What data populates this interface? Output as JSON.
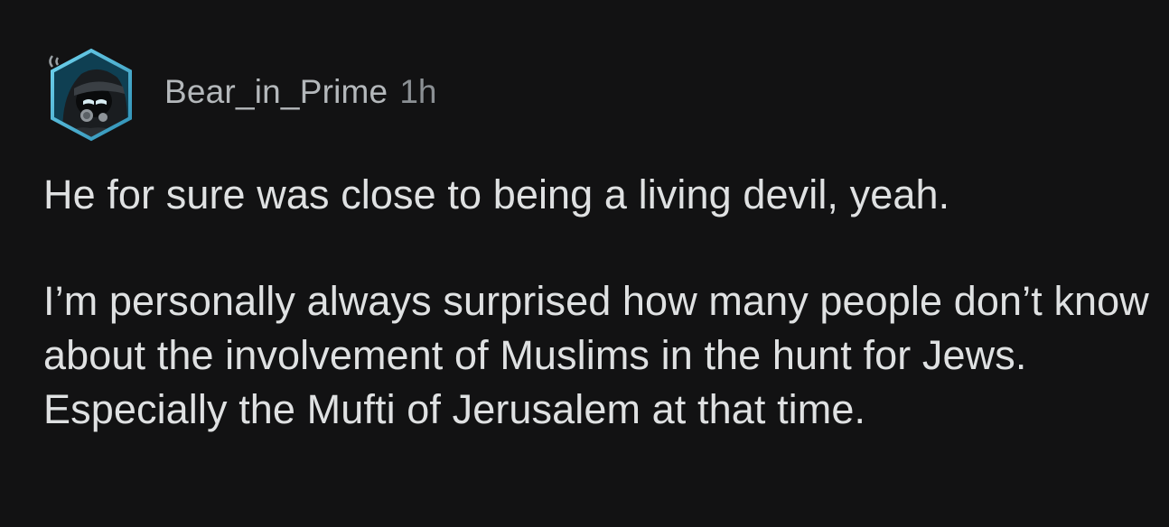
{
  "comment": {
    "author": "Bear_in_Prime",
    "timestamp": "1h",
    "avatar_icon": "hooded-avatar-icon",
    "paragraphs": [
      "He for sure was close to being a living devil, yeah.",
      "I’m personally always surprised how many people don’t know about the involvement of Muslims in the hunt for Jews. Especially the Mufti of Jerusalem at that time."
    ]
  },
  "colors": {
    "background": "#121213",
    "body_text": "#dfe1e2",
    "username": "#b4b8bb",
    "timestamp": "#8b9094",
    "avatar_ring": "#4fb7d4"
  }
}
